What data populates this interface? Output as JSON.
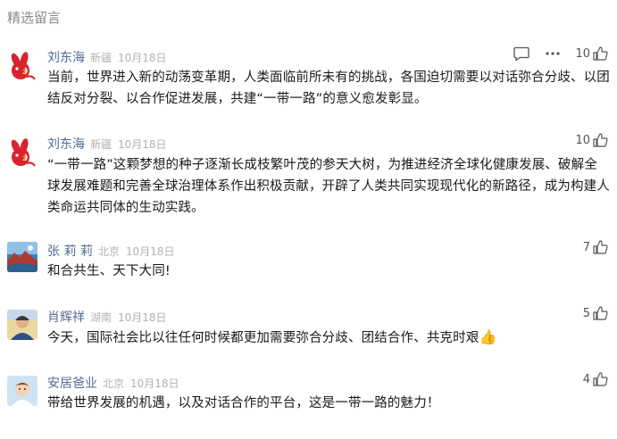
{
  "section_title": "精选留言",
  "comments": [
    {
      "user": "刘东海",
      "location": "新疆",
      "date": "10月18日",
      "likes": "10",
      "text": "当前，世界进入新的动荡变革期，人类面临前所未有的挑战，各国迫切需要以对话弥合分歧、以团结反对分裂、以合作促进发展，共建“一带一路”的意义愈发彰显。",
      "avatar_icon": "rabbit-avatar-icon"
    },
    {
      "user": "刘东海",
      "location": "新疆",
      "date": "10月18日",
      "likes": "10",
      "text": "“一带一路”这颗梦想的种子逐渐长成枝繁叶茂的参天大树，为推进经济全球化健康发展、破解全球发展难题和完善全球治理体系作出积极贡献，开辟了人类共同实现现代化的新路径，成为构建人类命运共同体的生动实践。",
      "avatar_icon": "rabbit-avatar-icon"
    },
    {
      "user": "张 莉 莉",
      "location": "北京",
      "date": "10月18日",
      "likes": "7",
      "text": "和合共生、天下大同!",
      "avatar_icon": "landscape-avatar-icon"
    },
    {
      "user": "肖辉祥",
      "location": "湖南",
      "date": "10月18日",
      "likes": "5",
      "text": "今天，国际社会比以往任何时候都更加需要弥合分歧、团结合作、共克时艰",
      "emoji": "👍",
      "avatar_icon": "person-avatar-icon"
    },
    {
      "user": "安居爸业",
      "location": "北京",
      "date": "10月18日",
      "likes": "4",
      "text": "带给世界发展的机遇，以及对话合作的平台，这是一带一路的魅力！",
      "avatar_icon": "cartoon-avatar-icon"
    }
  ],
  "icons": {
    "reply": "reply-icon",
    "more": "more-icon",
    "like": "thumbs-up-icon"
  }
}
